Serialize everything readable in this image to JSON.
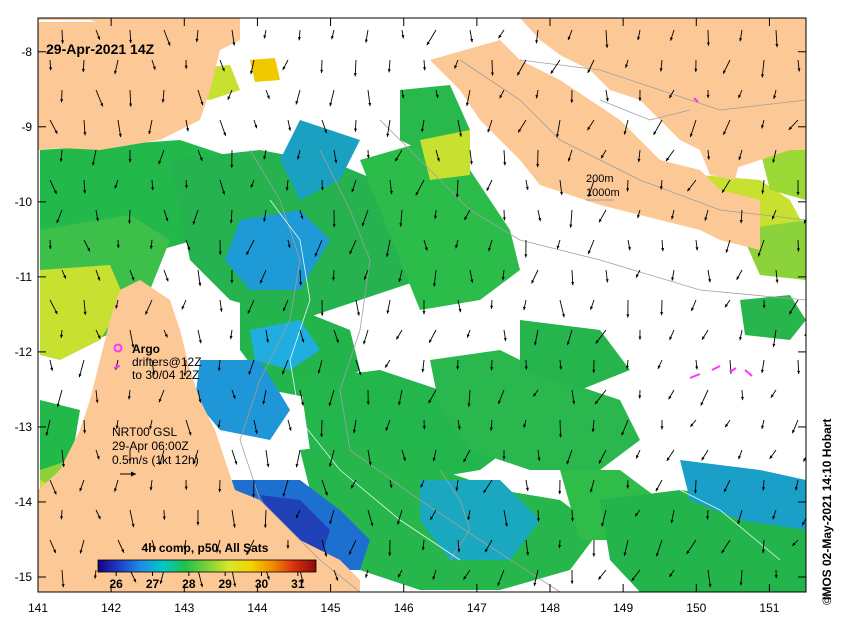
{
  "title": "29-Apr-2021 14Z",
  "axes": {
    "x_ticks": [
      "141",
      "142",
      "143",
      "144",
      "145",
      "146",
      "147",
      "148",
      "149",
      "150",
      "151"
    ],
    "y_ticks": [
      "-8",
      "-9",
      "-10",
      "-11",
      "-12",
      "-13",
      "-14",
      "-15"
    ],
    "xlim": [
      141,
      151.5
    ],
    "ylim": [
      -15.2,
      -7.55
    ]
  },
  "contour_legend": {
    "line1": "200m",
    "line2": "1000m"
  },
  "argo": {
    "label": "Argo",
    "line2": "drifters@12Z",
    "line3": "to 30/04 12Z"
  },
  "current_key": {
    "line1": "NRT00 GSL",
    "line2": "29-Apr 06:00Z",
    "line3": "0.5m/s (1kt 12h)"
  },
  "colorbar": {
    "title": "4h comp, p50, All Sats",
    "ticks": [
      "26",
      "27",
      "28",
      "29",
      "30",
      "31"
    ],
    "range": [
      25.5,
      31.5
    ],
    "colors": [
      "#1a0080",
      "#1e40c8",
      "#1e90e6",
      "#00c8c8",
      "#22c04a",
      "#7ad03a",
      "#d8e62a",
      "#f5d200",
      "#f08c00",
      "#d83010",
      "#8c0a0a"
    ]
  },
  "credit": "IMOS 02-May-2021 14:10 Hobart",
  "colors": {
    "land": "#fcc896",
    "cloud": "#ffffff",
    "argo": "#ff33ff"
  }
}
